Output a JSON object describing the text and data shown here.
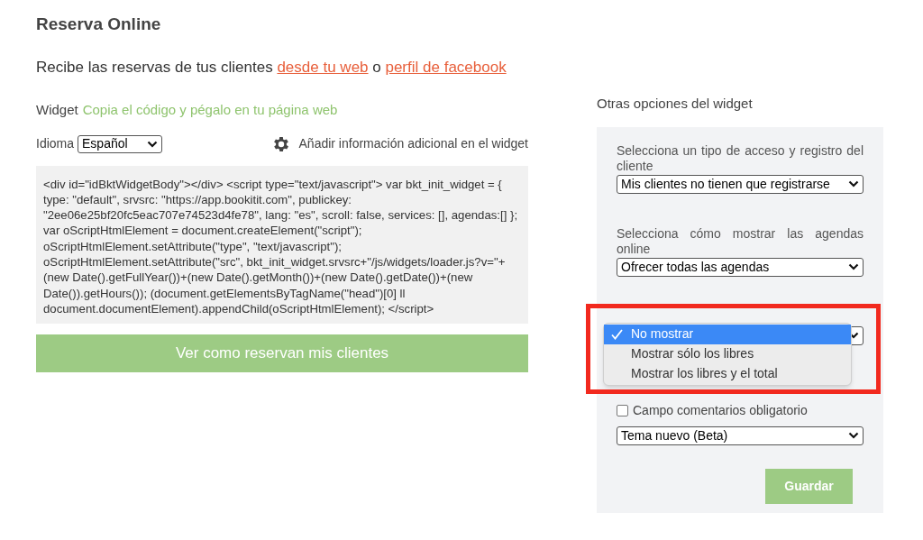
{
  "title": "Reserva Online",
  "intro": [
    {
      "kind": "text",
      "text": "Recibe las reservas de tus clientes "
    },
    {
      "kind": "link",
      "text": "desde tu web"
    },
    {
      "kind": "text",
      "text": " o "
    },
    {
      "kind": "link",
      "text": "perfil de facebook"
    }
  ],
  "widget": {
    "label": "Widget",
    "hint": "Copia el código y pégalo en tu página web"
  },
  "language": {
    "label": "Idioma",
    "value": "Español"
  },
  "extra_info": "Añadir información adicional en el widget",
  "code": "<div id=\"idBktWidgetBody\"></div> <script type=\"text/javascript\"> var bkt_init_widget = { type: \"default\", srvsrc: \"https://app.bookitit.com\", publickey: \"2ee06e25bf20fc5eac707e74523d4fe78\", lang: \"es\", scroll: false, services: [], agendas:[] }; var oScriptHtmlElement = document.createElement(\"script\"); oScriptHtmlElement.setAttribute(\"type\", \"text/javascript\"); oScriptHtmlElement.setAttribute(\"src\", bkt_init_widget.srvsrc+\"/js/widgets/loader.js?v=\"+(new Date().getFullYear())+(new Date().getMonth())+(new Date().getDate())+(new Date()).getHours()); (document.getElementsByTagName(\"head\")[0] ll document.documentElement).appendChild(oScriptHtmlElement); </script>",
  "preview_button": "Ver como reservan mis clientes",
  "options": {
    "heading": "Otras opciones del widget",
    "fields": [
      {
        "kind": "select",
        "label": "Selecciona un tipo de acceso y registro del cliente",
        "value": "Mis clientes no tienen que registrarse",
        "open": false
      },
      {
        "kind": "select",
        "label": "Selecciona cómo mostrar las agendas online",
        "value": "Ofrecer todas las agendas",
        "open": false
      },
      {
        "kind": "select",
        "open": true,
        "menu": [
          {
            "label": "No mostrar",
            "selected": true
          },
          {
            "label": "Mostrar sólo los libres",
            "selected": false
          },
          {
            "label": "Mostrar los libres y el total",
            "selected": false
          }
        ]
      },
      {
        "kind": "checkbox",
        "label": "Campo comentarios obligatorio",
        "checked": false
      },
      {
        "kind": "select",
        "value": "Tema nuevo (Beta)",
        "open": false
      }
    ],
    "save_button": "Guardar"
  },
  "highlight": true
}
